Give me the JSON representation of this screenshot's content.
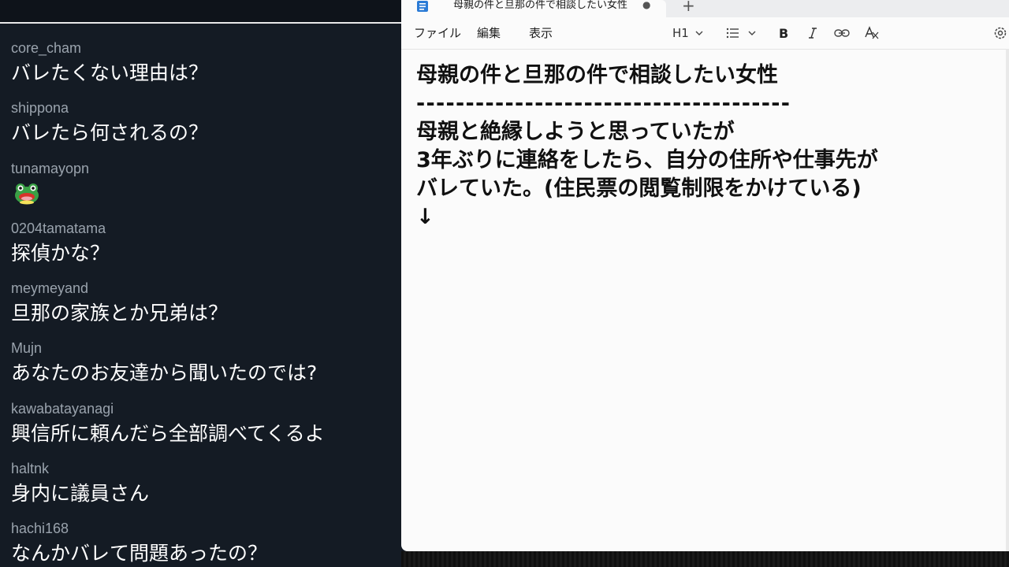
{
  "chat": {
    "messages": [
      {
        "user": "core_cham",
        "text": "バレたくない理由は？"
      },
      {
        "user": "shippona",
        "text": "バレたら何されるの？"
      },
      {
        "user": "tunamayopn",
        "text": "",
        "emote": "frog-emote"
      },
      {
        "user": "0204tamatama",
        "text": "探偵かな？"
      },
      {
        "user": "meymeyand",
        "text": "旦那の家族とか兄弟は？"
      },
      {
        "user": "Mujn",
        "text": "あなたのお友達から聞いたのでは?"
      },
      {
        "user": "kawabatayanagi",
        "text": "興信所に頼んだら全部調べてくるよ"
      },
      {
        "user": "haltnk",
        "text": "身内に議員さん"
      },
      {
        "user": "hachi168",
        "text": "なんかバレて問題あったの？"
      }
    ]
  },
  "notepad": {
    "tab_title": "母親の件と旦那の件で相談したい女性",
    "tab_unsaved_dot": "●",
    "new_tab_icon": "+",
    "menu": {
      "file": "ファイル",
      "edit": "編集",
      "view": "表示"
    },
    "toolbar": {
      "heading": "H1"
    },
    "lines": [
      "母親の件と旦那の件で相談したい女性",
      "--------------------------------------",
      "母親と絶縁しようと思っていたが",
      "3年ぶりに連絡をしたら、自分の住所や仕事先が",
      "バレていた。(住民票の閲覧制限をかけている)",
      "↓"
    ]
  },
  "colors": {
    "chat_bg": "#141b24",
    "chat_user": "#9aa3ad",
    "chat_text": "#ffffff",
    "editor_bg": "#fbfbfb"
  }
}
